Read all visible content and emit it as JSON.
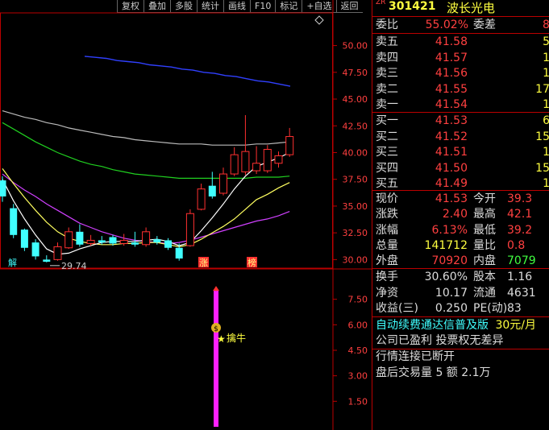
{
  "toolbar": {
    "buttons": [
      "复权",
      "叠加",
      "多股",
      "统计",
      "画线",
      "F10",
      "标记",
      "+自选",
      "返回"
    ]
  },
  "kline": {
    "price_ticks": [
      "50.00",
      "47.50",
      "45.00",
      "42.50",
      "40.00",
      "37.50",
      "35.00",
      "32.50",
      "30.00"
    ],
    "price_range": [
      29.2,
      52.0
    ],
    "low_label": "29.74",
    "low_value": 29.74,
    "candles": [
      {
        "o": 37.4,
        "h": 37.8,
        "c": 35.9,
        "l": 35.4
      },
      {
        "o": 34.8,
        "h": 35.2,
        "c": 32.3,
        "l": 32.0
      },
      {
        "o": 32.8,
        "h": 32.9,
        "c": 31.1,
        "l": 30.8
      },
      {
        "o": 31.6,
        "h": 31.9,
        "c": 30.3,
        "l": 30.0
      },
      {
        "o": 30.0,
        "h": 30.4,
        "c": 29.8,
        "l": 29.74
      },
      {
        "o": 30.0,
        "h": 31.6,
        "c": 31.2,
        "l": 29.9
      },
      {
        "o": 31.1,
        "h": 33.0,
        "c": 32.6,
        "l": 31.0
      },
      {
        "o": 32.6,
        "h": 33.3,
        "c": 31.4,
        "l": 31.2
      },
      {
        "o": 31.5,
        "h": 32.3,
        "c": 31.8,
        "l": 31.3
      },
      {
        "o": 31.8,
        "h": 32.2,
        "c": 31.6,
        "l": 31.4
      },
      {
        "o": 32.1,
        "h": 32.3,
        "c": 31.5,
        "l": 31.3
      },
      {
        "o": 31.5,
        "h": 32.4,
        "c": 31.8,
        "l": 31.3
      },
      {
        "o": 31.6,
        "h": 32.6,
        "c": 31.4,
        "l": 31.2
      },
      {
        "o": 31.4,
        "h": 33.0,
        "c": 32.6,
        "l": 31.2
      },
      {
        "o": 31.9,
        "h": 32.2,
        "c": 31.6,
        "l": 31.4
      },
      {
        "o": 31.8,
        "h": 32.0,
        "c": 31.1,
        "l": 30.9
      },
      {
        "o": 31.1,
        "h": 31.5,
        "c": 30.1,
        "l": 29.9
      },
      {
        "o": 31.3,
        "h": 34.7,
        "c": 34.3,
        "l": 31.2
      },
      {
        "o": 34.7,
        "h": 37.1,
        "c": 36.6,
        "l": 34.6
      },
      {
        "o": 36.9,
        "h": 38.2,
        "c": 35.9,
        "l": 35.7
      },
      {
        "o": 36.2,
        "h": 38.6,
        "c": 38.0,
        "l": 36.0
      },
      {
        "o": 38.0,
        "h": 40.5,
        "c": 39.8,
        "l": 37.8
      },
      {
        "o": 38.2,
        "h": 43.5,
        "c": 40.1,
        "l": 37.9
      },
      {
        "o": 38.3,
        "h": 40.6,
        "c": 39.0,
        "l": 38.0
      },
      {
        "o": 38.3,
        "h": 40.7,
        "c": 40.3,
        "l": 38.1
      },
      {
        "o": 39.0,
        "h": 40.1,
        "c": 39.7,
        "l": 38.6
      },
      {
        "o": 39.8,
        "h": 42.3,
        "c": 41.5,
        "l": 39.6
      }
    ],
    "ma_gray": [
      43.9,
      43.6,
      43.3,
      43.1,
      42.8,
      42.6,
      42.3,
      42.1,
      41.9,
      41.7,
      41.5,
      41.4,
      41.2,
      41.1,
      41.0,
      40.9,
      40.8,
      40.8,
      40.8,
      40.7,
      40.7,
      40.7,
      40.7,
      40.8,
      40.8,
      40.9,
      41.0
    ],
    "ma_green": [
      42.8,
      42.2,
      41.6,
      41.0,
      40.5,
      40.0,
      39.6,
      39.2,
      38.9,
      38.7,
      38.4,
      38.2,
      38.0,
      37.9,
      37.8,
      37.7,
      37.6,
      37.6,
      37.6,
      37.6,
      37.6,
      37.6,
      37.6,
      37.7,
      37.7,
      37.7,
      37.8
    ],
    "ma_magenta": [
      38.0,
      37.2,
      36.5,
      35.9,
      35.2,
      34.6,
      34.0,
      33.4,
      33.0,
      32.6,
      32.3,
      32.0,
      31.8,
      31.7,
      31.6,
      31.5,
      31.6,
      31.8,
      32.1,
      32.4,
      32.7,
      33.0,
      33.3,
      33.6,
      33.8,
      34.1,
      34.5
    ],
    "ma_yellow": [
      38.5,
      37.1,
      35.8,
      34.6,
      33.5,
      32.6,
      32.0,
      31.7,
      31.5,
      31.4,
      31.4,
      31.5,
      31.5,
      31.6,
      31.6,
      31.4,
      31.2,
      31.4,
      31.9,
      32.5,
      33.1,
      33.8,
      34.7,
      35.6,
      36.1,
      36.7,
      37.2
    ],
    "ma_white": [
      37.5,
      35.5,
      33.8,
      32.3,
      31.0,
      30.5,
      30.6,
      31.0,
      31.3,
      31.6,
      31.7,
      31.7,
      31.7,
      31.8,
      31.9,
      31.7,
      31.3,
      31.6,
      32.7,
      33.9,
      35.2,
      36.6,
      37.8,
      38.7,
      39.1,
      39.5,
      40.0
    ],
    "ma_blue_segment": [
      49.0,
      48.9,
      48.8,
      48.6,
      48.5,
      48.4,
      48.2,
      48.1,
      48.0,
      47.8,
      47.7,
      47.5,
      47.4,
      47.2,
      47.1,
      46.9,
      46.7,
      46.6,
      46.4,
      46.2
    ],
    "markers": {
      "jie": "解",
      "zhang": "涨",
      "bang": "榜"
    }
  },
  "indicator": {
    "ticks": [
      "7.50",
      "6.00",
      "4.50",
      "3.00",
      "1.50"
    ],
    "range": [
      0,
      9
    ],
    "bar_value": 8.0,
    "signal_label": "擒牛",
    "coin_symbol": "$",
    "star": "★"
  },
  "quote": {
    "zr": "ZR",
    "code": "301421",
    "name": "波长光电",
    "weibi_label": "委比",
    "weibi_value": "55.02%",
    "weicha_label": "委差",
    "weicha_value": "8",
    "asks": [
      {
        "label": "卖五",
        "price": "41.58",
        "vol": "5"
      },
      {
        "label": "卖四",
        "price": "41.57",
        "vol": "1"
      },
      {
        "label": "卖三",
        "price": "41.56",
        "vol": "1"
      },
      {
        "label": "卖二",
        "price": "41.55",
        "vol": "17"
      },
      {
        "label": "卖一",
        "price": "41.54",
        "vol": "1"
      }
    ],
    "bids": [
      {
        "label": "买一",
        "price": "41.53",
        "vol": "6"
      },
      {
        "label": "买二",
        "price": "41.52",
        "vol": "15"
      },
      {
        "label": "买三",
        "price": "41.51",
        "vol": "1"
      },
      {
        "label": "买四",
        "price": "41.50",
        "vol": "15"
      },
      {
        "label": "买五",
        "price": "41.49",
        "vol": "1"
      }
    ],
    "stats": [
      {
        "l1": "现价",
        "v1": "41.53",
        "c1": "red",
        "l2": "今开",
        "v2": "39.3",
        "c2": "red"
      },
      {
        "l1": "涨跌",
        "v1": "2.40",
        "c1": "red",
        "l2": "最高",
        "v2": "42.1",
        "c2": "red"
      },
      {
        "l1": "涨幅",
        "v1": "6.13%",
        "c1": "red",
        "l2": "最低",
        "v2": "39.2",
        "c2": "red"
      },
      {
        "l1": "总量",
        "v1": "141712",
        "c1": "yellow",
        "l2": "量比",
        "v2": "0.8",
        "c2": "red"
      },
      {
        "l1": "外盘",
        "v1": "70920",
        "c1": "red",
        "l2": "内盘",
        "v2": "7079",
        "c2": "green"
      }
    ],
    "fin": [
      {
        "l1": "换手",
        "v1": "30.60%",
        "l2": "股本",
        "v2": "1.16"
      },
      {
        "l1": "净资",
        "v1": "10.17",
        "l2": "流通",
        "v2": "4631"
      },
      {
        "l1": "收益(三)",
        "v1": "0.250",
        "l2": "PE(动)",
        "v2": "83"
      }
    ],
    "promo_text": "自动续费通达信普及版",
    "promo_price": "30元/月",
    "note1": "公司已盈利 投票权无差异",
    "note2": "行情连接已断开",
    "note3": "盘后交易量 5 额 2.1万"
  }
}
